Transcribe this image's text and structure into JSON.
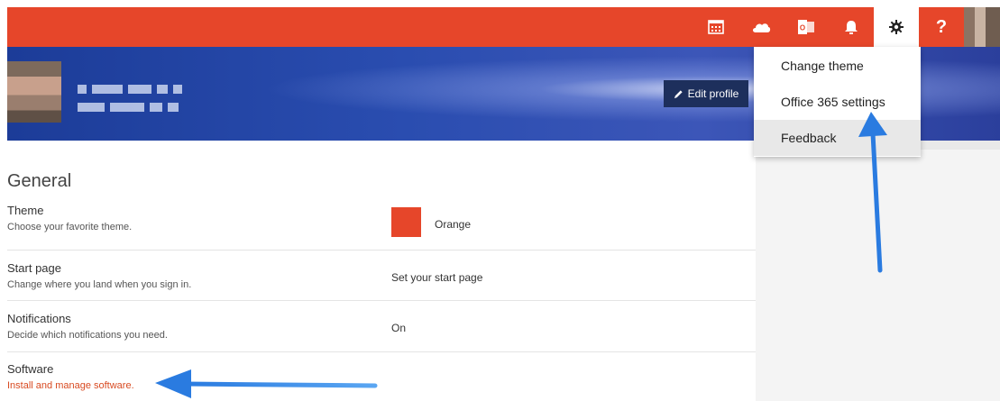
{
  "topbar": {
    "color": "#e6462a",
    "icons": [
      "calendar-icon",
      "onedrive-icon",
      "outlook-icon",
      "bell-icon",
      "gear-icon",
      "help-icon"
    ],
    "help_label": "?"
  },
  "profile": {
    "edit_label": "Edit profile",
    "icon": "pencil-icon"
  },
  "settings_menu": {
    "items": [
      {
        "label": "Change theme"
      },
      {
        "label": "Office 365 settings"
      },
      {
        "label": "Feedback"
      }
    ]
  },
  "general": {
    "title": "General",
    "rows": [
      {
        "title": "Theme",
        "desc": "Choose your favorite theme.",
        "value": "Orange",
        "swatch": "#e6462a"
      },
      {
        "title": "Start page",
        "desc": "Change where you land when you sign in.",
        "value": "Set your start page"
      },
      {
        "title": "Notifications",
        "desc": "Decide which notifications you need.",
        "value": "On"
      },
      {
        "title": "Software",
        "desc": "Install and manage software.",
        "value": ""
      }
    ]
  },
  "annotation": {
    "arrow_color": "#2a7be0"
  }
}
